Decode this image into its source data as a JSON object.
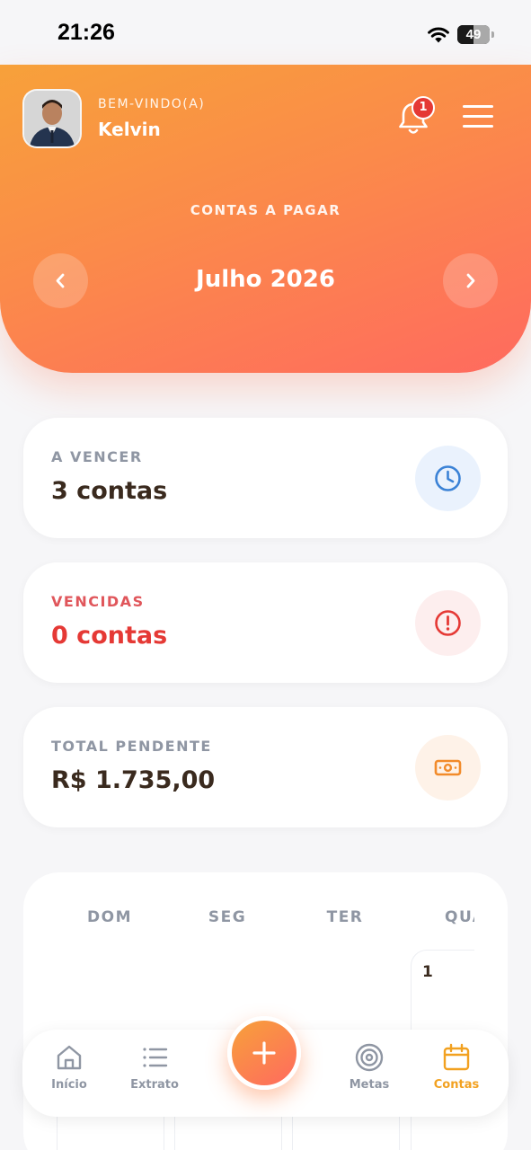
{
  "status_bar": {
    "time": "21:26",
    "battery": "49",
    "battery_level": 0.49
  },
  "header": {
    "welcome": "BEM-VINDO(A)",
    "username": "Kelvin",
    "notification_count": "1",
    "section_label": "CONTAS A PAGAR",
    "month": "Julho 2026"
  },
  "cards": [
    {
      "label": "A VENCER",
      "value": "3 contas",
      "icon": "clock-icon",
      "accent": "#3b82d6"
    },
    {
      "label": "VENCIDAS",
      "value": "0 contas",
      "icon": "alert-circle-icon",
      "accent": "#e53935"
    },
    {
      "label": "TOTAL PENDENTE",
      "value": "R$ 1.735,00",
      "icon": "money-icon",
      "accent": "#f28b2a"
    }
  ],
  "calendar": {
    "weekdays": [
      "DOM",
      "SEG",
      "TER",
      "QUA"
    ],
    "first_day": "1"
  },
  "bottom_nav": {
    "tabs": [
      {
        "label": "Início",
        "icon": "home-icon"
      },
      {
        "label": "Extrato",
        "icon": "list-icon"
      },
      {
        "label": "Metas",
        "icon": "target-icon"
      },
      {
        "label": "Contas",
        "icon": "calendar-icon"
      }
    ],
    "fab_icon": "plus-icon"
  },
  "colors": {
    "header_start": "#f7a13a",
    "header_end": "#ff6a5f",
    "active_tab": "#f2a120",
    "danger": "#e53935"
  }
}
